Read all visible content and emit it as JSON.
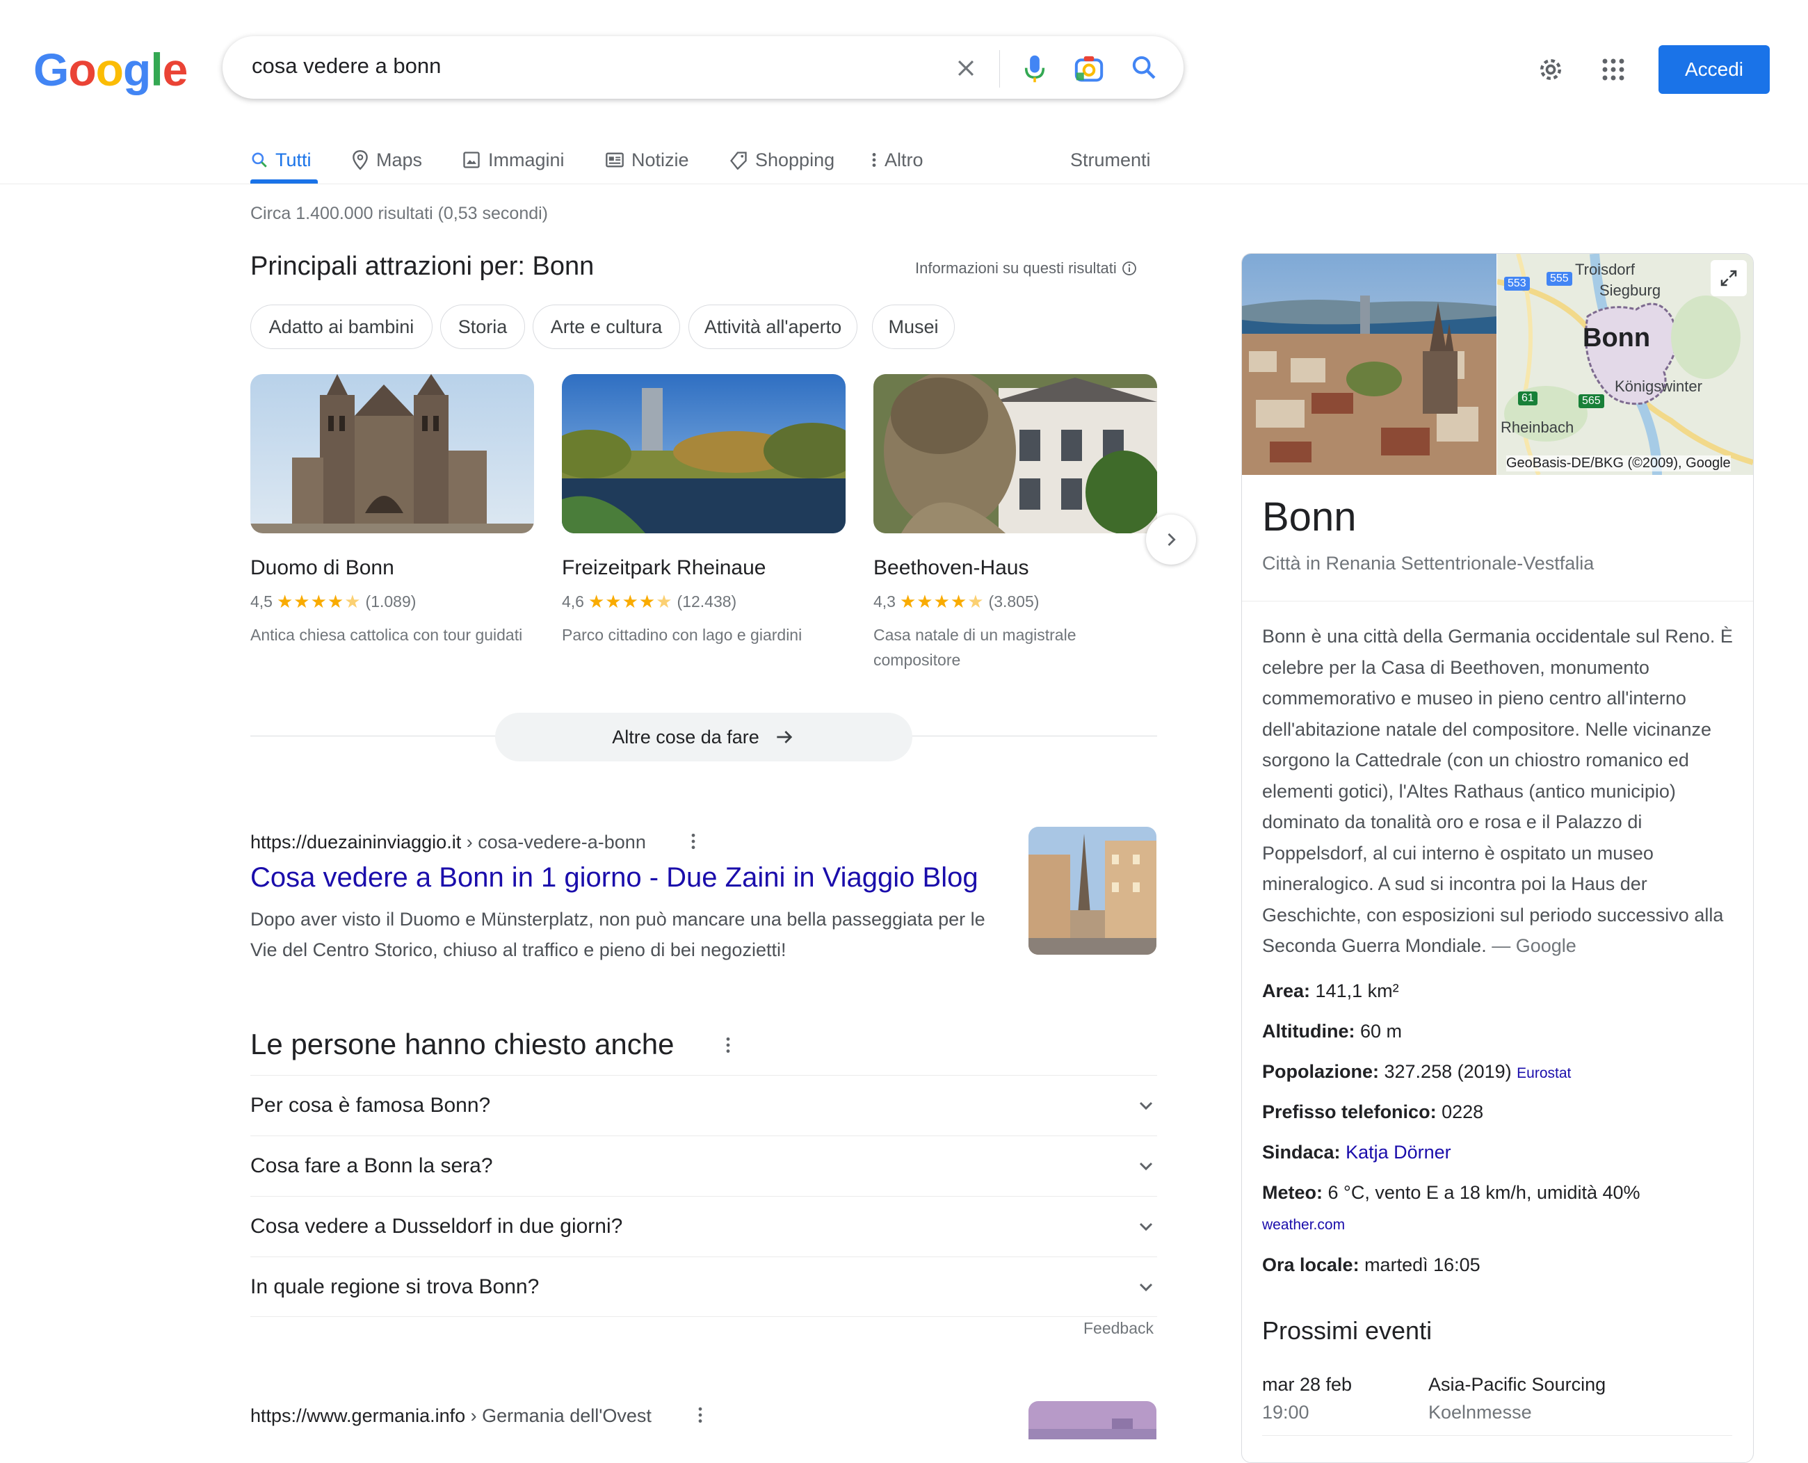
{
  "header": {
    "logo": "Google",
    "search_query": "cosa vedere a bonn",
    "signin_label": "Accedi"
  },
  "tabs": [
    {
      "label": "Tutti",
      "icon": "search-icon",
      "active": true
    },
    {
      "label": "Maps",
      "icon": "map-pin-icon"
    },
    {
      "label": "Immagini",
      "icon": "image-icon"
    },
    {
      "label": "Notizie",
      "icon": "news-icon"
    },
    {
      "label": "Shopping",
      "icon": "tag-icon"
    },
    {
      "label": "Altro",
      "icon": "more-vert-icon"
    }
  ],
  "tools_label": "Strumenti",
  "result_stats": "Circa 1.400.000 risultati (0,53 secondi)",
  "attractions": {
    "heading": "Principali attrazioni per: Bonn",
    "info_link": "Informazioni su questi risultati",
    "chips": [
      "Adatto ai bambini",
      "Storia",
      "Arte e cultura",
      "Attività all'aperto",
      "Musei"
    ],
    "cards": [
      {
        "title": "Duomo di Bonn",
        "rating": "4,5",
        "reviews": "(1.089)",
        "description": "Antica chiesa cattolica con tour guidati"
      },
      {
        "title": "Freizeitpark Rheinaue",
        "rating": "4,6",
        "reviews": "(12.438)",
        "description": "Parco cittadino con lago e giardini"
      },
      {
        "title": "Beethoven-Haus",
        "rating": "4,3",
        "reviews": "(3.805)",
        "description": "Casa natale di un magistrale compositore"
      }
    ],
    "more_label": "Altre cose da fare"
  },
  "result1": {
    "url": "https://duezaininviaggio.it",
    "path": " › cosa-vedere-a-bonn",
    "title": "Cosa vedere a Bonn in 1 giorno - Due Zaini in Viaggio Blog",
    "snippet": "Dopo aver visto il Duomo e Münsterplatz, non può mancare una bella passeggiata per le Vie del Centro Storico, chiuso al traffico e pieno di bei negozietti!"
  },
  "paa": {
    "heading": "Le persone hanno chiesto anche",
    "questions": [
      "Per cosa è famosa Bonn?",
      "Cosa fare a Bonn la sera?",
      "Cosa vedere a Dusseldorf in due giorni?",
      "In quale regione si trova Bonn?"
    ],
    "feedback": "Feedback"
  },
  "result2": {
    "url": "https://www.germania.info",
    "path": " › Germania dell'Ovest"
  },
  "knowledge_panel": {
    "map_labels": {
      "troisdorf": "Troisdorf",
      "siegburg": "Siegburg",
      "bonn": "Bonn",
      "konigswinter": "Königswinter",
      "rheinbach": "Rheinbach",
      "credit": "GeoBasis-DE/BKG (©2009), Google",
      "r553": "553",
      "r555": "555",
      "r61": "61",
      "r565": "565"
    },
    "title": "Bonn",
    "subtitle": "Città in Renania Settentrionale-Vestfalia",
    "description": "Bonn è una città della Germania occidentale sul Reno. È celebre per la Casa di Beethoven, monumento commemorativo e museo in pieno centro all'interno dell'abitazione natale del compositore. Nelle vicinanze sorgono la Cattedrale (con un chiostro romanico ed elementi gotici), l'Altes Rathaus (antico municipio) dominato da tonalità oro e rosa e il Palazzo di Poppelsdorf, al cui interno è ospitato un museo mineralogico. A sud si incontra poi la Haus der Geschichte, con esposizioni sul periodo successivo alla Seconda Guerra Mondiale.",
    "source": " — Google",
    "facts": {
      "area_label": "Area:",
      "area_value": " 141,1 km²",
      "alt_label": "Altitudine:",
      "alt_value": " 60 m",
      "pop_label": "Popolazione:",
      "pop_value": " 327.258 (2019) ",
      "pop_source": "Eurostat",
      "tel_label": "Prefisso telefonico:",
      "tel_value": " 0228",
      "mayor_label": "Sindaca:",
      "mayor_value": "Katja Dörner",
      "weather_label": "Meteo:",
      "weather_value": " 6 °C, vento E a 18 km/h, umidità 40%",
      "weather_source": "weather.com",
      "time_label": "Ora locale:",
      "time_value": " martedì 16:05"
    },
    "events_heading": "Prossimi eventi",
    "events": [
      {
        "date": "mar 28 feb",
        "time": "19:00",
        "name": "Asia-Pacific Sourcing",
        "venue": "Koelnmesse"
      }
    ]
  },
  "colors": {
    "accent": "#1a73e8",
    "link": "#1a0dab",
    "star": "#f9ab00"
  }
}
